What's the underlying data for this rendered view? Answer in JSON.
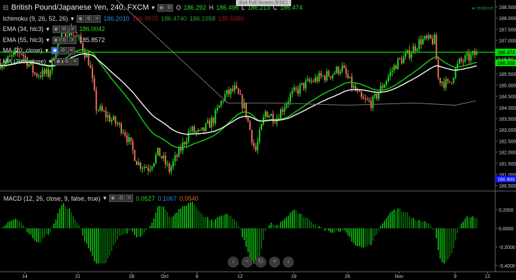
{
  "header": {
    "symbol": "British Pound/Japanese Yen, 240, FXCM",
    "O_label": "O",
    "O": "186.292",
    "H_label": "H",
    "H": "186.496",
    "L_label": "L",
    "L": "186.213",
    "C_label": "C",
    "C": "186.474"
  },
  "indicators": [
    {
      "name": "Ichimoku (9, 26, 52, 26)",
      "values": [
        {
          "v": "186.2010",
          "c": "b"
        },
        {
          "v": "186.9970",
          "c": "r"
        },
        {
          "v": "186.4740",
          "c": "dg"
        },
        {
          "v": "186.1958",
          "c": "dg"
        },
        {
          "v": "185.5980",
          "c": "r"
        }
      ]
    },
    {
      "name": "EMA (34, hlc3)",
      "values": [
        {
          "v": "186.0042",
          "c": "g"
        }
      ]
    },
    {
      "name": "EMA (55, hlc3)",
      "values": [
        {
          "v": "185.8572",
          "c": ""
        }
      ]
    },
    {
      "name": "MA (20, close)",
      "values": []
    },
    {
      "name": "MA (200, close)",
      "values": []
    }
  ],
  "exit_fullscreen": "Exit Full Screen (ESC)",
  "realtime": "realtime",
  "macd": {
    "name": "MACD (12, 26, close, 9, false, true)",
    "values": [
      "0.0527",
      "0.1067",
      "0.0540"
    ]
  },
  "price_badges": {
    "last": "186.474",
    "countdown": "2:16:50",
    "ema": "186.308",
    "low": "180.800"
  },
  "nav_buttons": [
    "‹",
    "−",
    "↻",
    "+",
    "›"
  ],
  "colors": {
    "up": "#22dd22",
    "down": "#f07058",
    "ema34": "#10d010",
    "ema55": "#f0f0f0",
    "ma200": "#777777",
    "lastline": "#00e000"
  },
  "chart_data": {
    "type": "candlestick",
    "title": "British Pound/Japanese Yen, 240, FXCM",
    "x_unit": "days since Sep 14",
    "close_path": [
      [
        -2.8,
        186.0
      ],
      [
        -0.5,
        186.5
      ],
      [
        1.3,
        185.5
      ],
      [
        3.1,
        185.5
      ],
      [
        4.4,
        187.0
      ],
      [
        5.7,
        187.5
      ],
      [
        7.1,
        187.0
      ],
      [
        8.4,
        186.0
      ],
      [
        9.3,
        184.0
      ],
      [
        11.1,
        183.5
      ],
      [
        12.9,
        183.0
      ],
      [
        14.7,
        181.5
      ],
      [
        16.1,
        181.3
      ],
      [
        17.4,
        182.0
      ],
      [
        18.8,
        181.2
      ],
      [
        20.1,
        182.0
      ],
      [
        21.5,
        183.0
      ],
      [
        22.8,
        182.8
      ],
      [
        24.6,
        183.5
      ],
      [
        25.9,
        184.5
      ],
      [
        27.3,
        184.8
      ],
      [
        28.6,
        184.0
      ],
      [
        30.0,
        182.0
      ],
      [
        31.3,
        183.8
      ],
      [
        32.7,
        183.5
      ],
      [
        34.5,
        184.5
      ],
      [
        36.3,
        185.0
      ],
      [
        38.1,
        185.3
      ],
      [
        39.9,
        185.5
      ],
      [
        41.2,
        185.8
      ],
      [
        42.5,
        185.0
      ],
      [
        43.9,
        184.3
      ],
      [
        45.2,
        184.2
      ],
      [
        46.6,
        185.0
      ],
      [
        48.4,
        186.0
      ],
      [
        49.7,
        186.3
      ],
      [
        51.5,
        187.0
      ],
      [
        53.3,
        187.0
      ],
      [
        53.8,
        185.3
      ],
      [
        55.1,
        185.0
      ],
      [
        56.5,
        186.0
      ],
      [
        58.7,
        186.4
      ]
    ],
    "ma200_path": [
      [
        9.5,
        189.5
      ],
      [
        12.0,
        188.8
      ],
      [
        26.4,
        184.2
      ],
      [
        32.7,
        184.2
      ],
      [
        41.7,
        184.1
      ],
      [
        50.7,
        184.2
      ],
      [
        56.0,
        184.1
      ],
      [
        58.7,
        184.3
      ]
    ],
    "x_ticks": [
      {
        "d": 0,
        "label": "14"
      },
      {
        "d": 6.9,
        "label": "21"
      },
      {
        "d": 13.9,
        "label": "28"
      },
      {
        "d": 18.2,
        "label": "Oct"
      },
      {
        "d": 22.4,
        "label": "6"
      },
      {
        "d": 28.0,
        "label": "12"
      },
      {
        "d": 35.0,
        "label": "19"
      },
      {
        "d": 42.0,
        "label": "26"
      },
      {
        "d": 48.7,
        "label": "Nov"
      },
      {
        "d": 56.0,
        "label": "9"
      },
      {
        "d": 60.2,
        "label": "12"
      }
    ],
    "y_ticks": [
      "188.500",
      "188.000",
      "187.500",
      "187.000",
      "186.500",
      "186.000",
      "185.500",
      "185.000",
      "184.500",
      "184.000",
      "183.500",
      "183.000",
      "182.500",
      "182.000",
      "181.500",
      "181.000",
      "180.500"
    ],
    "ylim": [
      180.5,
      188.5
    ],
    "macd_ticks": [
      "0.2000",
      "0.0000",
      "-0.2000",
      "-0.4000"
    ],
    "macd_ylim": [
      -0.4,
      0.2
    ]
  }
}
